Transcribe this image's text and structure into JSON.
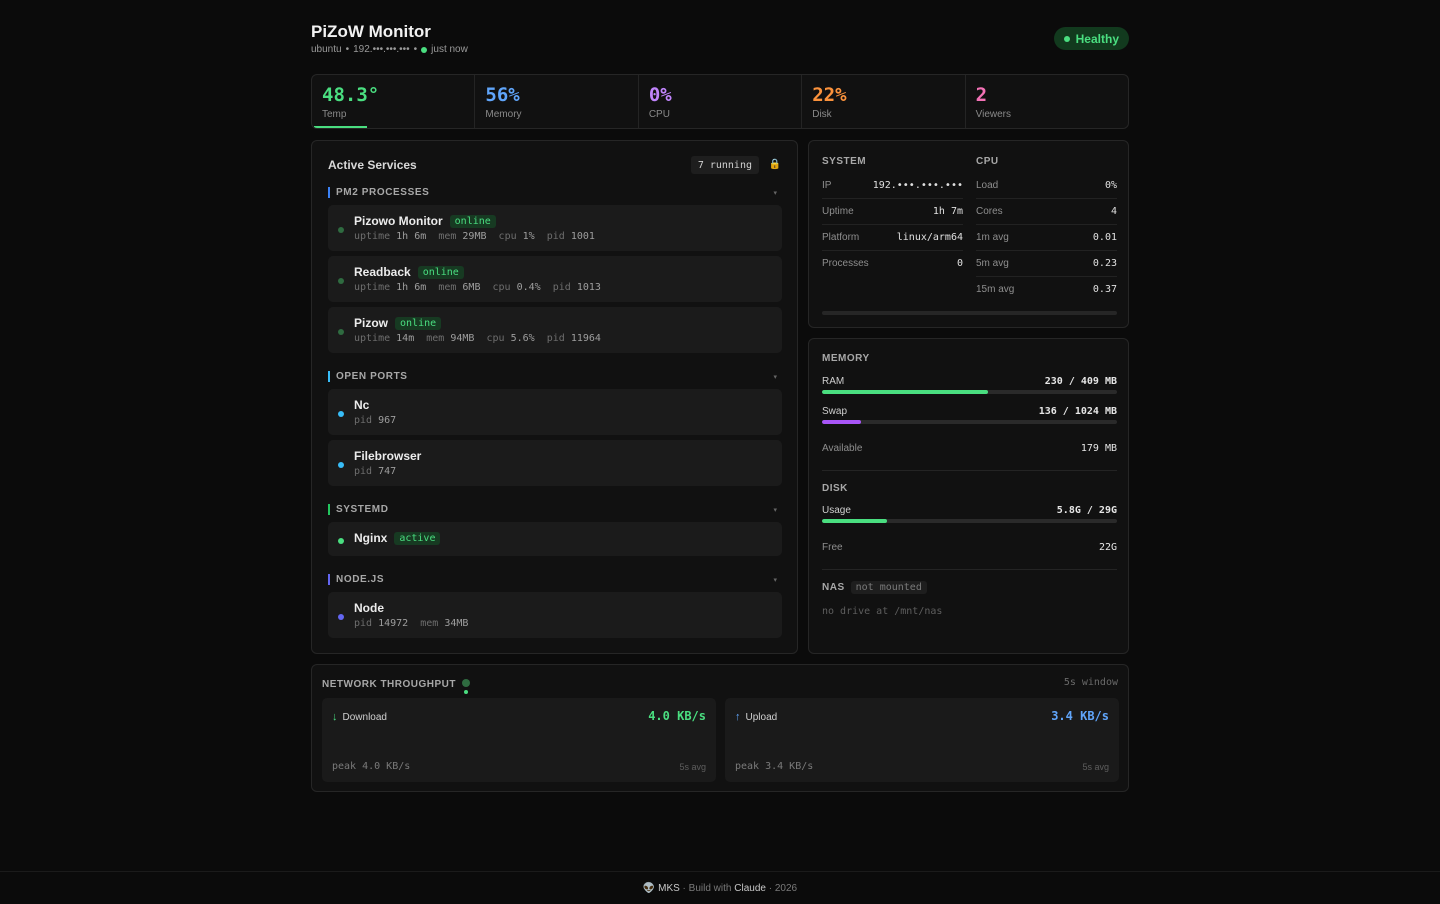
{
  "header": {
    "title": "PiZoW Monitor",
    "host": "ubuntu",
    "ip": "192.•••.•••.•••",
    "updated": "just now",
    "health": "Healthy"
  },
  "stats": [
    {
      "value": "48.3°",
      "label": "Temp",
      "color": "#4ade80"
    },
    {
      "value": "56%",
      "label": "Memory",
      "color": "#60a5fa"
    },
    {
      "value": "0%",
      "label": "CPU",
      "color": "#c084fc"
    },
    {
      "value": "22%",
      "label": "Disk",
      "color": "#fb923c"
    },
    {
      "value": "2",
      "label": "Viewers",
      "color": "#f472b6"
    }
  ],
  "services": {
    "title": "Active Services",
    "running": "7 running",
    "sections": {
      "pm2": "PM2 PROCESSES",
      "ports": "OPEN PORTS",
      "systemd": "SYSTEMD",
      "node": "NODE.JS"
    },
    "pm2": [
      {
        "name": "Pizowo Monitor",
        "status": "online",
        "uptime": "1h 6m",
        "mem": "29MB",
        "cpu": "1%",
        "pid": "1001"
      },
      {
        "name": "Readback",
        "status": "online",
        "uptime": "1h 6m",
        "mem": "6MB",
        "cpu": "0.4%",
        "pid": "1013"
      },
      {
        "name": "Pizow",
        "status": "online",
        "uptime": "14m",
        "mem": "94MB",
        "cpu": "5.6%",
        "pid": "11964"
      }
    ],
    "ports": [
      {
        "name": "Nc",
        "pid": "967"
      },
      {
        "name": "Filebrowser",
        "pid": "747"
      }
    ],
    "systemd": [
      {
        "name": "Nginx",
        "status": "active"
      }
    ],
    "node": [
      {
        "name": "Node",
        "pid": "14972",
        "mem": "34MB"
      }
    ],
    "labels": {
      "uptime": "uptime",
      "mem": "mem",
      "cpu": "cpu",
      "pid": "pid"
    }
  },
  "system": {
    "heading": "SYSTEM",
    "rows": [
      {
        "k": "IP",
        "v": "192.•••.•••.•••"
      },
      {
        "k": "Uptime",
        "v": "1h 7m"
      },
      {
        "k": "Platform",
        "v": "linux/arm64"
      },
      {
        "k": "Processes",
        "v": "0"
      }
    ]
  },
  "cpu": {
    "heading": "CPU",
    "rows": [
      {
        "k": "Load",
        "v": "0%"
      },
      {
        "k": "Cores",
        "v": "4"
      },
      {
        "k": "1m avg",
        "v": "0.01"
      },
      {
        "k": "5m avg",
        "v": "0.23"
      },
      {
        "k": "15m avg",
        "v": "0.37"
      }
    ]
  },
  "memory": {
    "heading": "MEMORY",
    "ram": {
      "label": "RAM",
      "value": "230 / 409 MB",
      "fraction": 0.5623
    },
    "swap": {
      "label": "Swap",
      "value": "136 / 1024 MB",
      "fraction": 0.1328
    },
    "available": {
      "label": "Available",
      "value": "179 MB"
    }
  },
  "disk": {
    "heading": "DISK",
    "usage": {
      "label": "Usage",
      "value": "5.8G / 29G",
      "fraction": 0.22
    },
    "free": {
      "label": "Free",
      "value": "22G"
    }
  },
  "nas": {
    "heading": "NAS",
    "status": "not mounted",
    "note": "no drive at /mnt/nas"
  },
  "network": {
    "title": "NETWORK THROUGHPUT",
    "window": "5s window",
    "download": {
      "label": "Download",
      "value": "4.0 KB/s",
      "peak": "peak 4.0 KB/s",
      "avg": "5s avg"
    },
    "upload": {
      "label": "Upload",
      "value": "3.4 KB/s",
      "peak": "peak 3.4 KB/s",
      "avg": "5s avg"
    }
  },
  "footer": {
    "brand": "MKS",
    "built": "Build with",
    "tool": "Claude",
    "year": "2026"
  },
  "colors": {
    "green": "#4ade80",
    "blue": "#60a5fa",
    "purple": "#a855f7",
    "cyan": "#38bdf8",
    "node": "#6366f1"
  }
}
